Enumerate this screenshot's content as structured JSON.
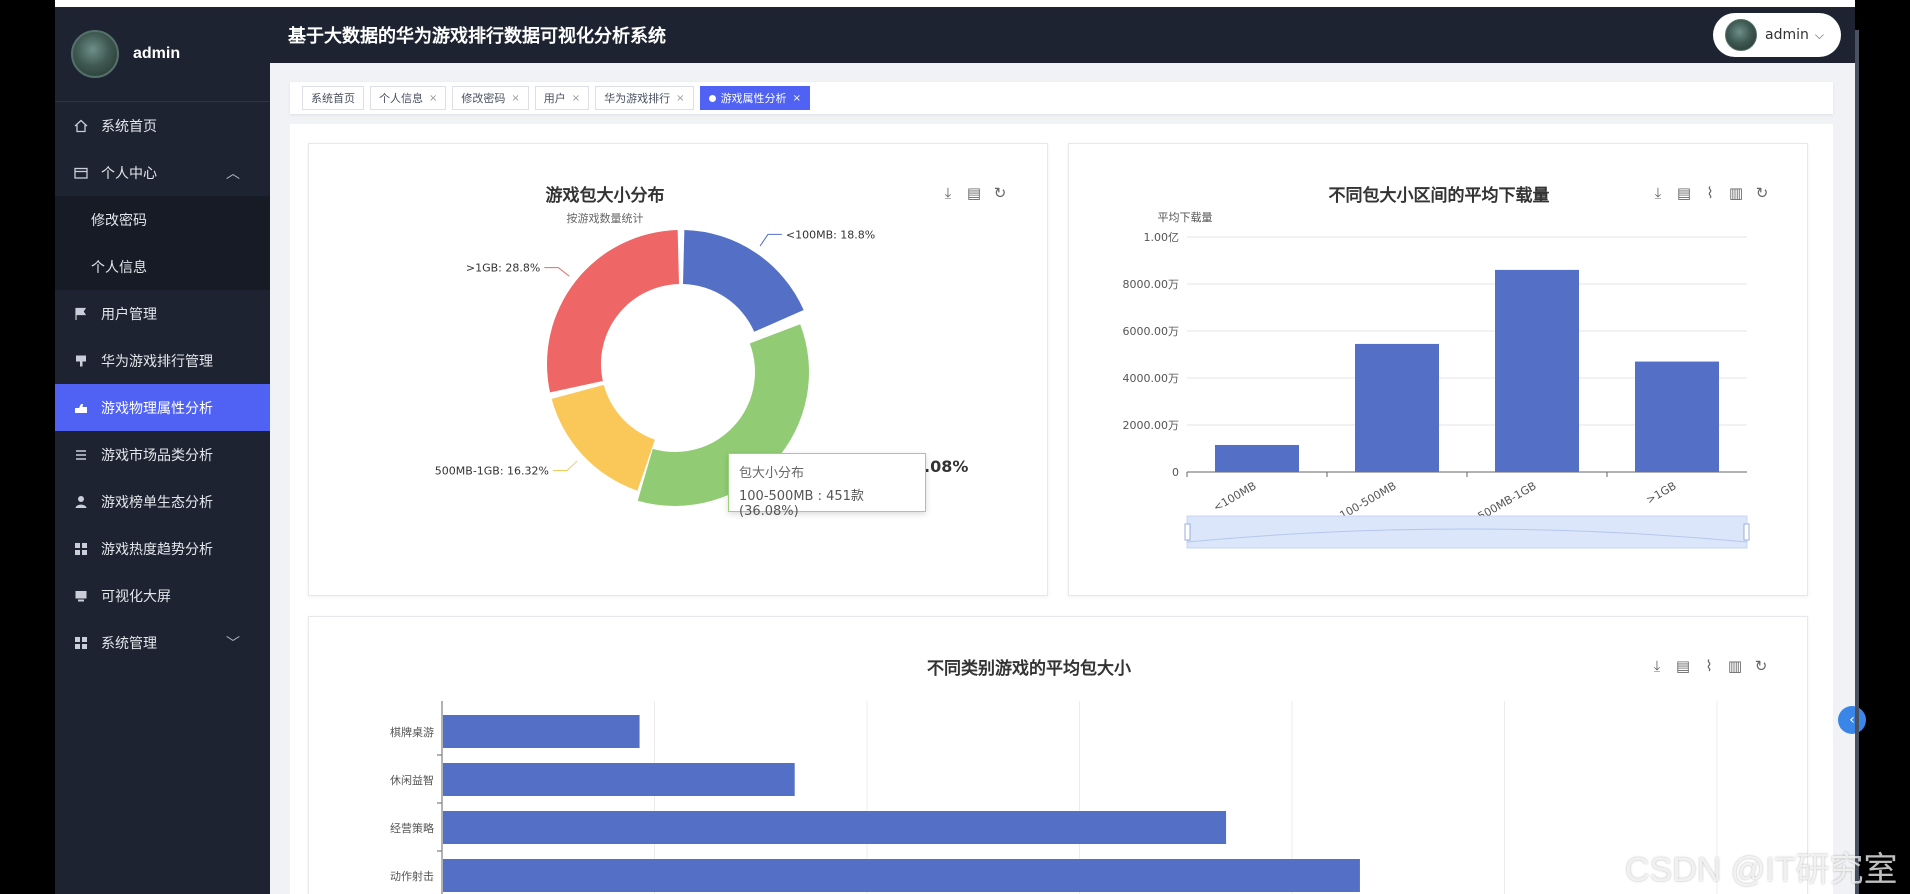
{
  "header": {
    "title": "基于大数据的华为游戏排行数据可视化分析系统",
    "user": "admin"
  },
  "sidebar": {
    "user": "admin",
    "items": [
      {
        "label": "系统首页",
        "icon": "home-icon"
      },
      {
        "label": "个人中心",
        "icon": "wallet-icon",
        "expanded": true
      },
      {
        "label": "修改密码",
        "sub": true
      },
      {
        "label": "个人信息",
        "sub": true
      },
      {
        "label": "用户管理",
        "icon": "flag-icon"
      },
      {
        "label": "华为游戏排行管理",
        "icon": "brush-icon"
      },
      {
        "label": "游戏物理属性分析",
        "icon": "hand-icon",
        "active": true
      },
      {
        "label": "游戏市场品类分析",
        "icon": "list-icon"
      },
      {
        "label": "游戏榜单生态分析",
        "icon": "person-icon"
      },
      {
        "label": "游戏热度趋势分析",
        "icon": "grid-icon"
      },
      {
        "label": "可视化大屏",
        "icon": "screen-icon"
      },
      {
        "label": "系统管理",
        "icon": "grid-icon",
        "expandable": true
      }
    ]
  },
  "tags": [
    {
      "label": "系统首页",
      "closable": false
    },
    {
      "label": "个人信息",
      "closable": true
    },
    {
      "label": "修改密码",
      "closable": true
    },
    {
      "label": "用户",
      "closable": true
    },
    {
      "label": "华为游戏排行",
      "closable": true
    },
    {
      "label": "游戏属性分析",
      "closable": true,
      "active": true
    }
  ],
  "charts": {
    "pie_title": "游戏包大小分布",
    "pie_subtitle": "按游戏数量统计",
    "bar_title": "不同包大小区间的平均下载量",
    "bar_ylabel": "平均下载量",
    "hbar_title": "不同类别游戏的平均包大小",
    "center_value_partial": ".08%",
    "tooltip": {
      "title": "包大小分布",
      "text": "100-500MB : 451款 (36.08%)"
    }
  },
  "chart_data": [
    {
      "type": "pie",
      "title": "游戏包大小分布",
      "subtitle": "按游戏数量统计",
      "labels": [
        "<100MB",
        "100-500MB",
        "500MB-1GB",
        ">1GB"
      ],
      "values": [
        18.8,
        36.08,
        16.32,
        28.8
      ],
      "value_unit": "%",
      "counts": {
        "100-500MB": 451
      },
      "colors": [
        "#5470c6",
        "#91cc75",
        "#fac858",
        "#ee6666"
      ],
      "label_texts": [
        "<100MB: 18.8%",
        "",
        "500MB-1GB: 16.32%",
        ">1GB: 28.8%"
      ]
    },
    {
      "type": "bar",
      "title": "不同包大小区间的平均下载量",
      "ylabel": "平均下载量",
      "categories": [
        "<100MB",
        "100-500MB",
        "500MB-1GB",
        ">1GB"
      ],
      "values": [
        1150,
        5450,
        8600,
        4700
      ],
      "unit": "万",
      "ylim": [
        0,
        10000
      ],
      "yticks": [
        "0",
        "2000.00万",
        "4000.00万",
        "6000.00万",
        "8000.00万",
        "1.00亿"
      ],
      "color": "#5470c6"
    },
    {
      "type": "bar",
      "orientation": "horizontal",
      "title": "不同类别游戏的平均包大小",
      "categories": [
        "棋牌桌游",
        "休闲益智",
        "经营策略",
        "动作射击"
      ],
      "values": [
        185,
        331,
        737,
        863
      ],
      "xlim": [
        0,
        1200
      ],
      "color": "#5470c6"
    }
  ],
  "watermark": "CSDN @IT研究室"
}
